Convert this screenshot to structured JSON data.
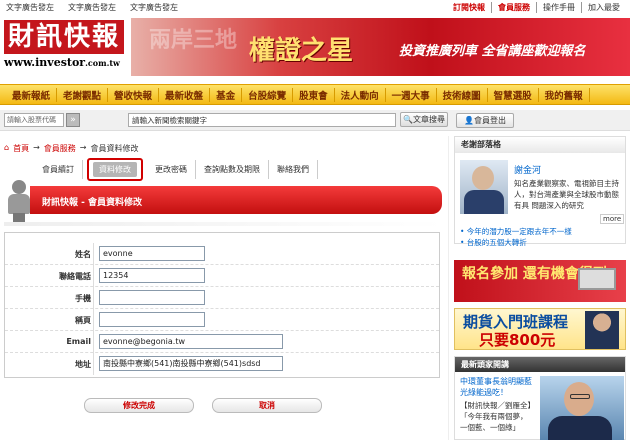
{
  "top_ads": [
    "文字廣告發左",
    "文字廣告發左",
    "文字廣告發左"
  ],
  "top_nav": {
    "subscribe": "訂閱快報",
    "member": "會員服務",
    "manual": "操作手冊",
    "favorite": "加入最愛"
  },
  "logo": {
    "main": "財訊快報",
    "url_main": "www.investor",
    "url_suffix": ".com.tw"
  },
  "banner": {
    "deco": "兩岸三地",
    "title": "權證之星",
    "subtitle": "投資推廣列車 全省講座歡迎報名"
  },
  "main_nav": [
    "最新報紙",
    "老謝觀點",
    "營收快報",
    "最新收盤",
    "基金",
    "台股綜覽",
    "股東會",
    "法人動向",
    "一週大事",
    "技術線圖",
    "智慧選股",
    "我的舊報"
  ],
  "search": {
    "stock_placeholder": "請輸入股票代碼",
    "news_placeholder": "請輸入新聞檢索關鍵字",
    "search_btn": "文章搜尋",
    "login_btn": "會員登出"
  },
  "breadcrumb": {
    "home": "首頁",
    "sep": "→",
    "service": "會員服務",
    "current": "會員資料修改"
  },
  "tabs": [
    "會員續訂",
    "資料修改",
    "更改密碼",
    "查詢點數及期限",
    "聯絡我們"
  ],
  "header_title": "財訊快報 - 會員資料修改",
  "form": {
    "name_label": "姓名",
    "name_value": "evonne",
    "phone_label": "聯絡電話",
    "phone_value": "12354",
    "mobile_label": "手機",
    "mobile_value": "",
    "title_label": "稱頁",
    "title_value": "",
    "email_label": "Email",
    "email_value": "evonne@begonia.tw",
    "address_label": "地址",
    "address_value": "南投縣中寮鄉(541)南投縣中寮鄉(541)sdsd"
  },
  "buttons": {
    "submit": "修改完成",
    "cancel": "取消"
  },
  "analyst": {
    "title": "老謝部落格",
    "name": "謝金河",
    "desc": "知名產業觀察家、電視節目主持人，對台灣產業與全球股市動態有具 問題深入的研究",
    "more": "more",
    "link1": "• 今年的潛力股一定跟去年不一樣",
    "link2": "• 台股的五個大轉折"
  },
  "ads": {
    "ad1": "報名參加 還有機會得到",
    "ad2_line1": "期貨入門班課程",
    "ad2_line2": "只要800元"
  },
  "news_box": {
    "title": "最新頭家開講",
    "headline": "中環董事長翁明顯藍光綠能過吃！",
    "body": "【財訊快報／劉雁全】「今年我有兩個夢，一個藍、一個綠」"
  }
}
